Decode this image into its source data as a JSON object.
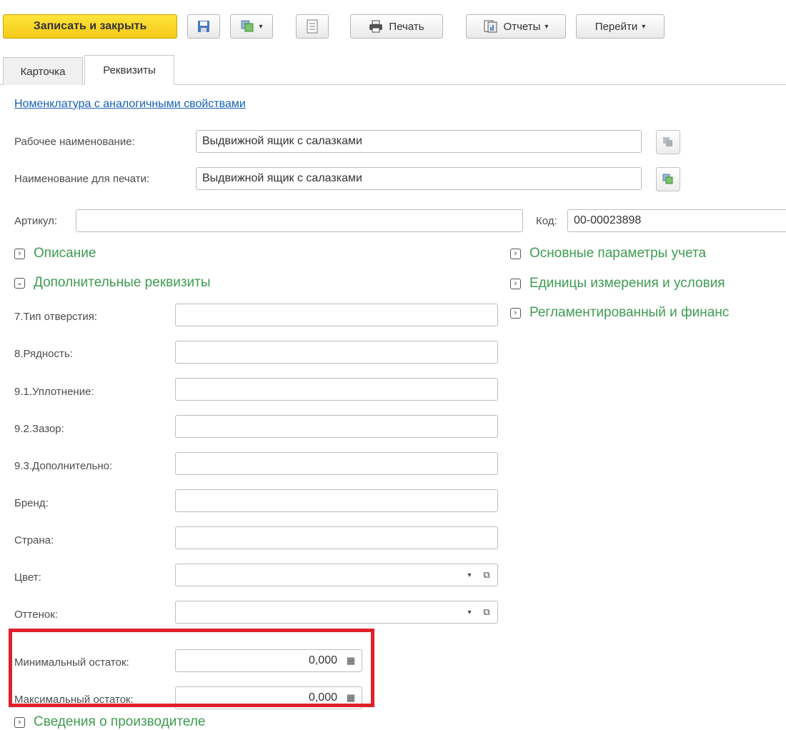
{
  "toolbar": {
    "save_close_label": "Записать и закрыть",
    "print_label": "Печать",
    "reports_label": "Отчеты",
    "goto_label": "Перейти"
  },
  "tabs": [
    {
      "label": "Карточка",
      "active": false
    },
    {
      "label": "Реквизиты",
      "active": true
    }
  ],
  "link_similar": "Номенклатура с аналогичными свойствами",
  "fields": {
    "work_name_label": "Рабочее наименование:",
    "work_name_value": "Выдвижной ящик с салазками",
    "print_name_label": "Наименование для печати:",
    "print_name_value": "Выдвижной ящик с салазками",
    "article_label": "Артикул:",
    "article_value": "",
    "code_label": "Код:",
    "code_value": "00-00023898"
  },
  "groups": {
    "description": "Описание",
    "additional": "Дополнительные реквизиты",
    "main_params": "Основные параметры учета",
    "units": "Единицы измерения и условия",
    "regulated": "Регламентированный и финанс",
    "manufacturer": "Сведения о производителе"
  },
  "extra_attrs": [
    {
      "label": "7.Тип отверстия:",
      "value": ""
    },
    {
      "label": "8.Рядность:",
      "value": ""
    },
    {
      "label": "9.1.Уплотнение:",
      "value": ""
    },
    {
      "label": "9.2.Зазор:",
      "value": ""
    },
    {
      "label": "9.3.Дополнительно:",
      "value": ""
    },
    {
      "label": "Бренд:",
      "value": ""
    },
    {
      "label": "Страна:",
      "value": ""
    },
    {
      "label": "Цвет:",
      "value": ""
    },
    {
      "label": "Оттенок:",
      "value": ""
    }
  ],
  "stock": {
    "min_label": "Минимальный остаток:",
    "min_value": "0,000",
    "max_label": "Максимальный остаток:",
    "max_value": "0,000"
  },
  "colors": {
    "accent_yellow": "#f3c919",
    "group_green": "#3f9c52",
    "link_blue": "#1a5fb4",
    "highlight_red": "#e0202a"
  }
}
